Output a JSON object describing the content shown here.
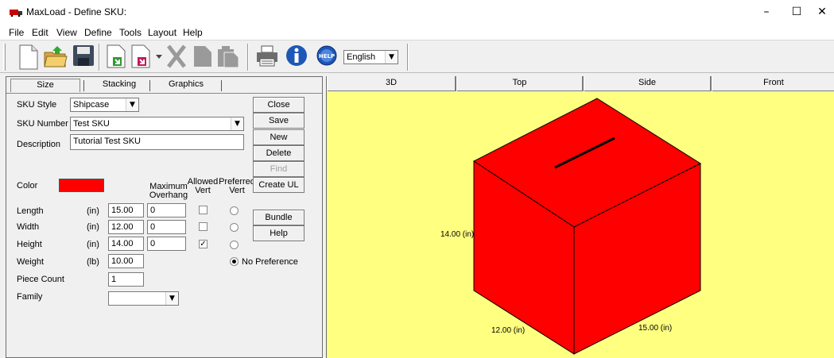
{
  "window": {
    "title": "MaxLoad - Define SKU:",
    "controls": {
      "minimize": "–",
      "maximize": "☐",
      "close": "✕"
    }
  },
  "menu": [
    "File",
    "Edit",
    "View",
    "Define",
    "Tools",
    "Layout",
    "Help"
  ],
  "toolbar": {
    "language": "English",
    "icons": [
      "new-document-icon",
      "open-folder-icon",
      "save-disk-icon",
      "import-sku-icon",
      "export-sku-icon",
      "export-dropdown-icon",
      "cut-icon",
      "copy-icon",
      "paste-icon",
      "print-icon",
      "info-icon",
      "help-icon"
    ]
  },
  "tabs": [
    "Size",
    "Stacking",
    "Graphics"
  ],
  "form": {
    "sku_style_label": "SKU Style",
    "sku_style_value": "Shipcase",
    "sku_number_label": "SKU Number",
    "sku_number_value": "Test SKU",
    "description_label": "Description",
    "description_value": "Tutorial Test SKU",
    "color_label": "Color",
    "color_value": "#ff0000",
    "max_overhang_header": [
      "Maximum",
      "Overhang"
    ],
    "allowed_vert_header": [
      "Allowed",
      "Vert"
    ],
    "preferred_vert_header": [
      "Preferred",
      "Vert"
    ],
    "rows": [
      {
        "label": "Length",
        "unit": "(in)",
        "value": "15.00",
        "overhang": "0",
        "allowed": false,
        "preferred": false
      },
      {
        "label": "Width",
        "unit": "(in)",
        "value": "12.00",
        "overhang": "0",
        "allowed": false,
        "preferred": false
      },
      {
        "label": "Height",
        "unit": "(in)",
        "value": "14.00",
        "overhang": "0",
        "allowed": true,
        "preferred": false
      }
    ],
    "weight_label": "Weight",
    "weight_unit": "(lb)",
    "weight_value": "10.00",
    "no_preference_label": "No Preference",
    "no_preference_checked": true,
    "piece_count_label": "Piece Count",
    "piece_count_value": "1",
    "family_label": "Family",
    "family_value": ""
  },
  "buttons": {
    "close": "Close",
    "save": "Save",
    "new": "New",
    "delete": "Delete",
    "find": "Find",
    "create_ul": "Create UL",
    "bundle": "Bundle",
    "help": "Help"
  },
  "views": [
    "3D",
    "Top",
    "Side",
    "Front"
  ],
  "box": {
    "color": "#ff0000",
    "height_label": "14.00 (in)",
    "width_label": "12.00 (in)",
    "length_label": "15.00 (in)"
  },
  "colors": {
    "canvas": "#ffff80",
    "box": "#ff0000"
  }
}
